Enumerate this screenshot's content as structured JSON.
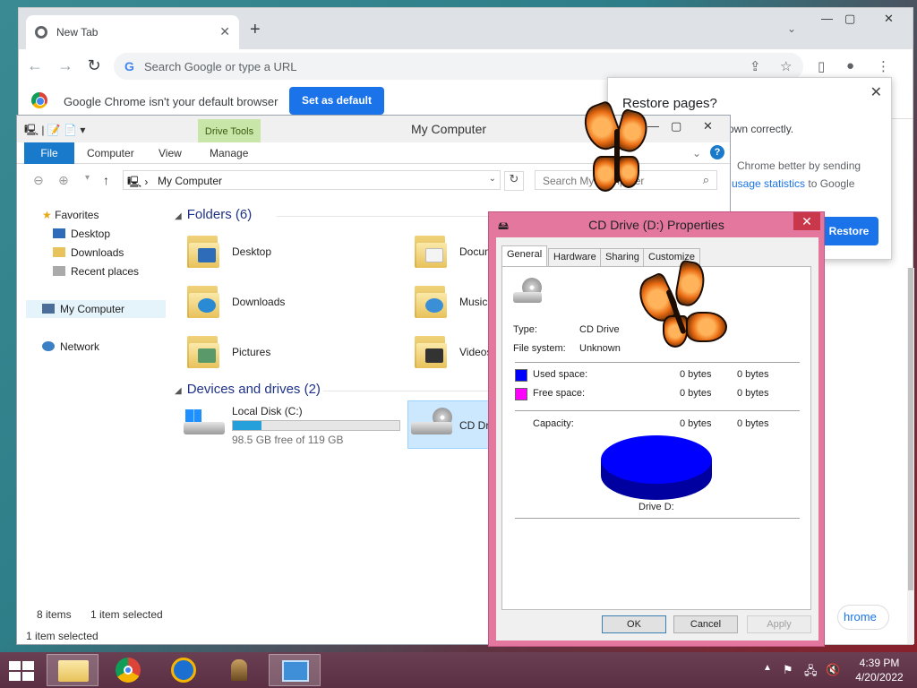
{
  "chrome": {
    "tab_title": "New Tab",
    "tab_close": "✕",
    "new_tab": "+",
    "tab_search": "⌄",
    "window_controls": {
      "minimize": "—",
      "maximize": "▢",
      "close": "✕"
    },
    "nav": {
      "back": "←",
      "forward": "→",
      "reload": "↻"
    },
    "omnibox_placeholder": "Search Google or type a URL",
    "infobar": {
      "message": "Google Chrome isn't your default browser",
      "button": "Set as default"
    },
    "restore": {
      "title": "Restore pages?",
      "line1": "own correctly.",
      "line2": "Chrome better by sending",
      "line3_link": "usage statistics",
      "line3_rest": " to Google",
      "button": "Restore"
    },
    "bottom_button": "hrome"
  },
  "explorer": {
    "title": "My Computer",
    "contextual_tab": "Drive Tools",
    "ribbon_tabs": [
      "File",
      "Computer",
      "View",
      "Manage"
    ],
    "address": "My Computer",
    "search_placeholder": "Search My Computer",
    "nav_pane": {
      "favorites": "Favorites",
      "favorite_items": [
        "Desktop",
        "Downloads",
        "Recent places"
      ],
      "my_computer": "My Computer",
      "network": "Network"
    },
    "folders_header": "Folders (6)",
    "folders": [
      "Desktop",
      "Documents",
      "Downloads",
      "Music",
      "Pictures",
      "Videos"
    ],
    "devices_header": "Devices and drives (2)",
    "drives": [
      {
        "name": "Local Disk (C:)",
        "free": "98.5 GB free of 119 GB",
        "used_fraction": 0.17
      },
      {
        "name": "CD Drive (D:)"
      }
    ],
    "status": {
      "items": "8 items",
      "selected": "1 item selected"
    },
    "bottom_status": "1 item selected"
  },
  "props": {
    "title": "CD Drive (D:) Properties",
    "tabs": [
      "General",
      "Hardware",
      "Sharing",
      "Customize"
    ],
    "type_label": "Type:",
    "type_value": "CD Drive",
    "fs_label": "File system:",
    "fs_value": "Unknown",
    "used_label": "Used space:",
    "free_label": "Free space:",
    "capacity_label": "Capacity:",
    "bytes_col1": "0 bytes",
    "bytes_col2": "0 bytes",
    "drive_caption": "Drive D:",
    "buttons": {
      "ok": "OK",
      "cancel": "Cancel",
      "apply": "Apply"
    },
    "colors": {
      "used": "#0000ff",
      "free": "#ff00ff"
    }
  },
  "taskbar": {
    "time": "4:39 PM",
    "date": "4/20/2022"
  }
}
